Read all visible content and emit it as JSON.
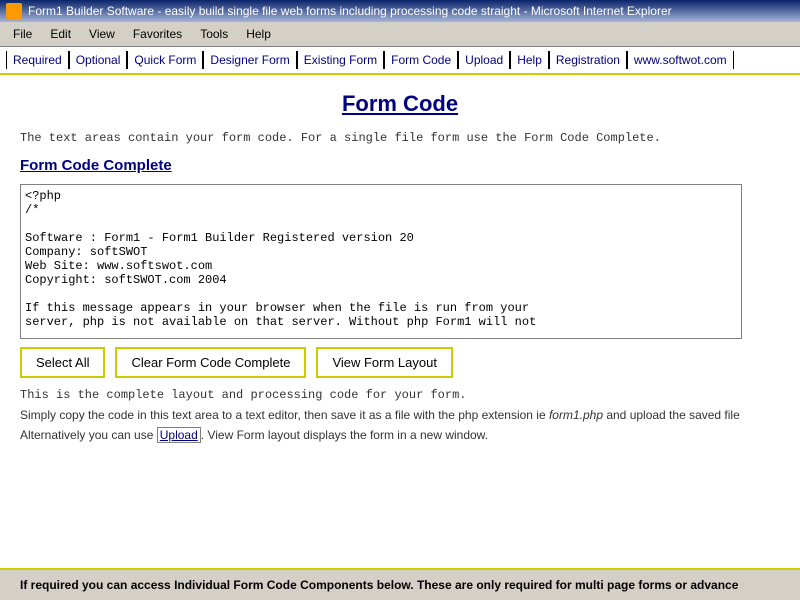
{
  "window": {
    "title": "Form1 Builder Software - easily build single file web forms including processing code straight  - Microsoft Internet Explorer"
  },
  "menubar": {
    "items": [
      "File",
      "Edit",
      "View",
      "Favorites",
      "Tools",
      "Help"
    ]
  },
  "navbar": {
    "links": [
      "Required",
      "Optional",
      "Quick Form",
      "Designer Form",
      "Existing Form",
      "Form Code",
      "Upload",
      "Help",
      "Registration",
      "www.softwot.com"
    ]
  },
  "page": {
    "title": "Form Code",
    "description": "The text areas contain your form code. For a single file form use the Form Code Complete.",
    "section_title": "Form Code Complete",
    "code_content": "<?php\n/*\n\nSoftware : Form1 - Form1 Builder Registered version 20\nCompany: softSWOT\nWeb Site: www.softswot.com\nCopyright: softSWOT.com 2004\n\nIf this message appears in your browser when the file is run from your\nserver, php is not available on that server. Without php Form1 will not",
    "buttons": {
      "select_all": "Select All",
      "clear_form": "Clear Form Code Complete",
      "view_layout": "View Form Layout"
    },
    "info1": "This is the complete layout and processing code for your form.",
    "info2_prefix": "Simply copy the code in this text area to a text editor, then save it as a file with the php extension ie ",
    "info2_filename": "form1.php",
    "info2_suffix": " and upload the saved file",
    "info3_prefix": "Alternatively you can use ",
    "info3_upload": "Upload",
    "info3_suffix": ". View Form layout displays the form in a new window.",
    "bottom_text": "If required you can access Individual Form Code Components below. These are only required for multi page forms or advance"
  }
}
